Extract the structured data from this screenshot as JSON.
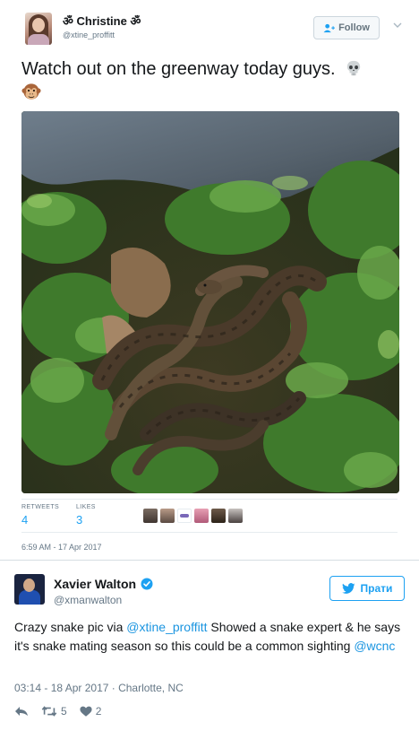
{
  "embedded_tweet": {
    "author": {
      "name": "Christine",
      "om_symbol": "ॐ",
      "handle": "@xtine_proffitt"
    },
    "follow_label": "Follow",
    "text": "Watch out on the greenway today guys.",
    "emoji": [
      "skull",
      "monkey-face"
    ],
    "photo_alt": "snakes",
    "stats": {
      "retweets_label": "RETWEETS",
      "retweets": "4",
      "likes_label": "LIKES",
      "likes": "3"
    },
    "timestamp": "6:59 AM - 17 Apr 2017"
  },
  "reply_tweet": {
    "author": {
      "name": "Xavier Walton",
      "handle": "@xmanwalton",
      "verified": true
    },
    "follow_label": "Прати",
    "text_parts": {
      "p1": "Crazy snake pic via ",
      "mention1": "@xtine_proffitt",
      "p2": " Showed a snake expert & he says it's snake mating season so this could be a common sighting ",
      "mention2": "@wcnc"
    },
    "timestamp": "03:14 - 18 Apr 2017 · Charlotte, NC",
    "actions": {
      "retweets": "5",
      "likes": "2"
    }
  },
  "colors": {
    "link": "#1b95e0",
    "accent": "#1da1f2",
    "muted": "#657786"
  }
}
